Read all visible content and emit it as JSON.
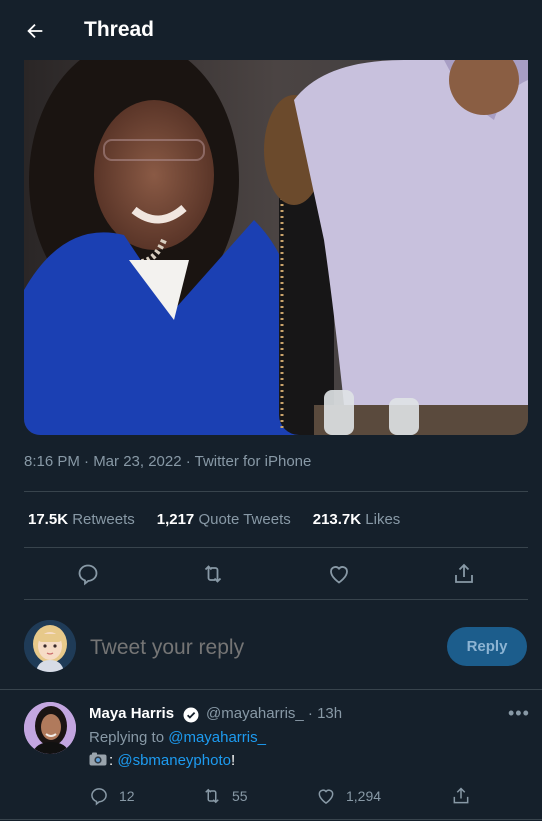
{
  "header": {
    "title": "Thread",
    "back_icon": "arrow-left-icon"
  },
  "tweet": {
    "meta": "8:16 PM · Mar 23, 2022 · Twitter for iPhone",
    "stats": {
      "retweets_count": "17.5K",
      "retweets_label": "Retweets",
      "quotes_count": "1,217",
      "quotes_label": "Quote Tweets",
      "likes_count": "213.7K",
      "likes_label": "Likes"
    },
    "actions": [
      "reply-icon",
      "retweet-icon",
      "like-icon",
      "share-icon"
    ]
  },
  "compose": {
    "placeholder": "Tweet your reply",
    "reply_button": "Reply"
  },
  "reply_tweet": {
    "name": "Maya Harris",
    "handle": "@mayaharris_ · 13h",
    "replying_prefix": "Replying to ",
    "replying_to": "@mayaharris_",
    "body_prefix": ": ",
    "body_link": "@sbmaneyphoto",
    "body_suffix": "!",
    "replies": "12",
    "retweets": "55",
    "likes": "1,294",
    "more": "•••"
  },
  "colors": {
    "background": "#15202b",
    "accent": "#1d9bf0",
    "muted": "#8899a6",
    "divider": "#38444d"
  }
}
